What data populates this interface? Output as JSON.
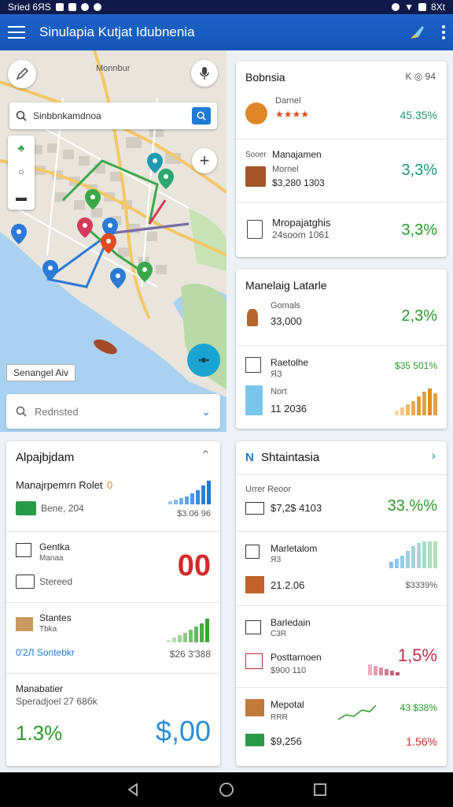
{
  "status": {
    "left_text": "Sried 6ЯS",
    "right_text": "8Xt"
  },
  "appbar": {
    "title": "Sinulapia Kutjat Idubnenia"
  },
  "map": {
    "search_text": "Sinbbnkamdnoa",
    "place_labels": [
      "Monnbur"
    ],
    "location_label": "Senangel Aiv",
    "dropdown_text": "Rednsted"
  },
  "card_bosnia": {
    "title": "Bobnsia",
    "header_controls": "K  ◎ 94",
    "rows": [
      {
        "label": "Darnel",
        "rating": "★★★★",
        "pct": "45.35%"
      },
      {
        "label": "Manajamen",
        "prefix": "Sooer",
        "sub": "Mornel",
        "value": "$3,280 1303",
        "pct": "3,3%"
      },
      {
        "label": "Mropajatghis",
        "sub": "24soom 1061",
        "pct": "3,3%"
      }
    ]
  },
  "card_latarle": {
    "title": "Manelaig Latarle",
    "rows": [
      {
        "label": "Gomals",
        "value": "33,000",
        "pct": "2,3%"
      },
      {
        "label": "Raetolhe",
        "sub": "ЯЗ",
        "sub2": "Nort",
        "value": "11 2036",
        "pct": "$35 501%"
      }
    ]
  },
  "card_alpajbjdam": {
    "title": "Alpajbjdam",
    "rows": [
      {
        "label": "Manajrpemrn Rolet",
        "badge": "0",
        "sub": "Bene, 204",
        "value": "$3.06 96"
      },
      {
        "label": "Gentka",
        "sub": "Manaa",
        "sub2": "Stereed",
        "value": "00"
      },
      {
        "label": "Stantes",
        "sub": "Tbka",
        "sub2": "0'2Л Sontebkr",
        "value": "$26 3'388"
      },
      {
        "label": "Manabatier",
        "sub": "Speradjoel 27 68бk",
        "pct": "1.3%",
        "value": "$,00"
      }
    ]
  },
  "card_shtaintasia": {
    "title": "Shtaintasia",
    "rows": [
      {
        "label": "Urrer Reoor",
        "value": "$7,2$ 4103",
        "pct": "33.%%"
      },
      {
        "label": "Marletalom",
        "sub": "ЯЗ",
        "value": "21.2.06",
        "sub2": "$3339%"
      },
      {
        "label": "Barledain",
        "sub": "C3R",
        "sub2": "Posttarnoen",
        "value": "$900 110",
        "pct": "1,5%"
      },
      {
        "label": "Mepotal",
        "sub": "RRR",
        "value": "$9,256",
        "pct": "1.56%",
        "note": "43 $38%"
      }
    ]
  },
  "colors": {
    "primary": "#1e63c9",
    "green": "#2a9a2a",
    "red": "#d42a2a",
    "blue": "#2a8fd6"
  }
}
